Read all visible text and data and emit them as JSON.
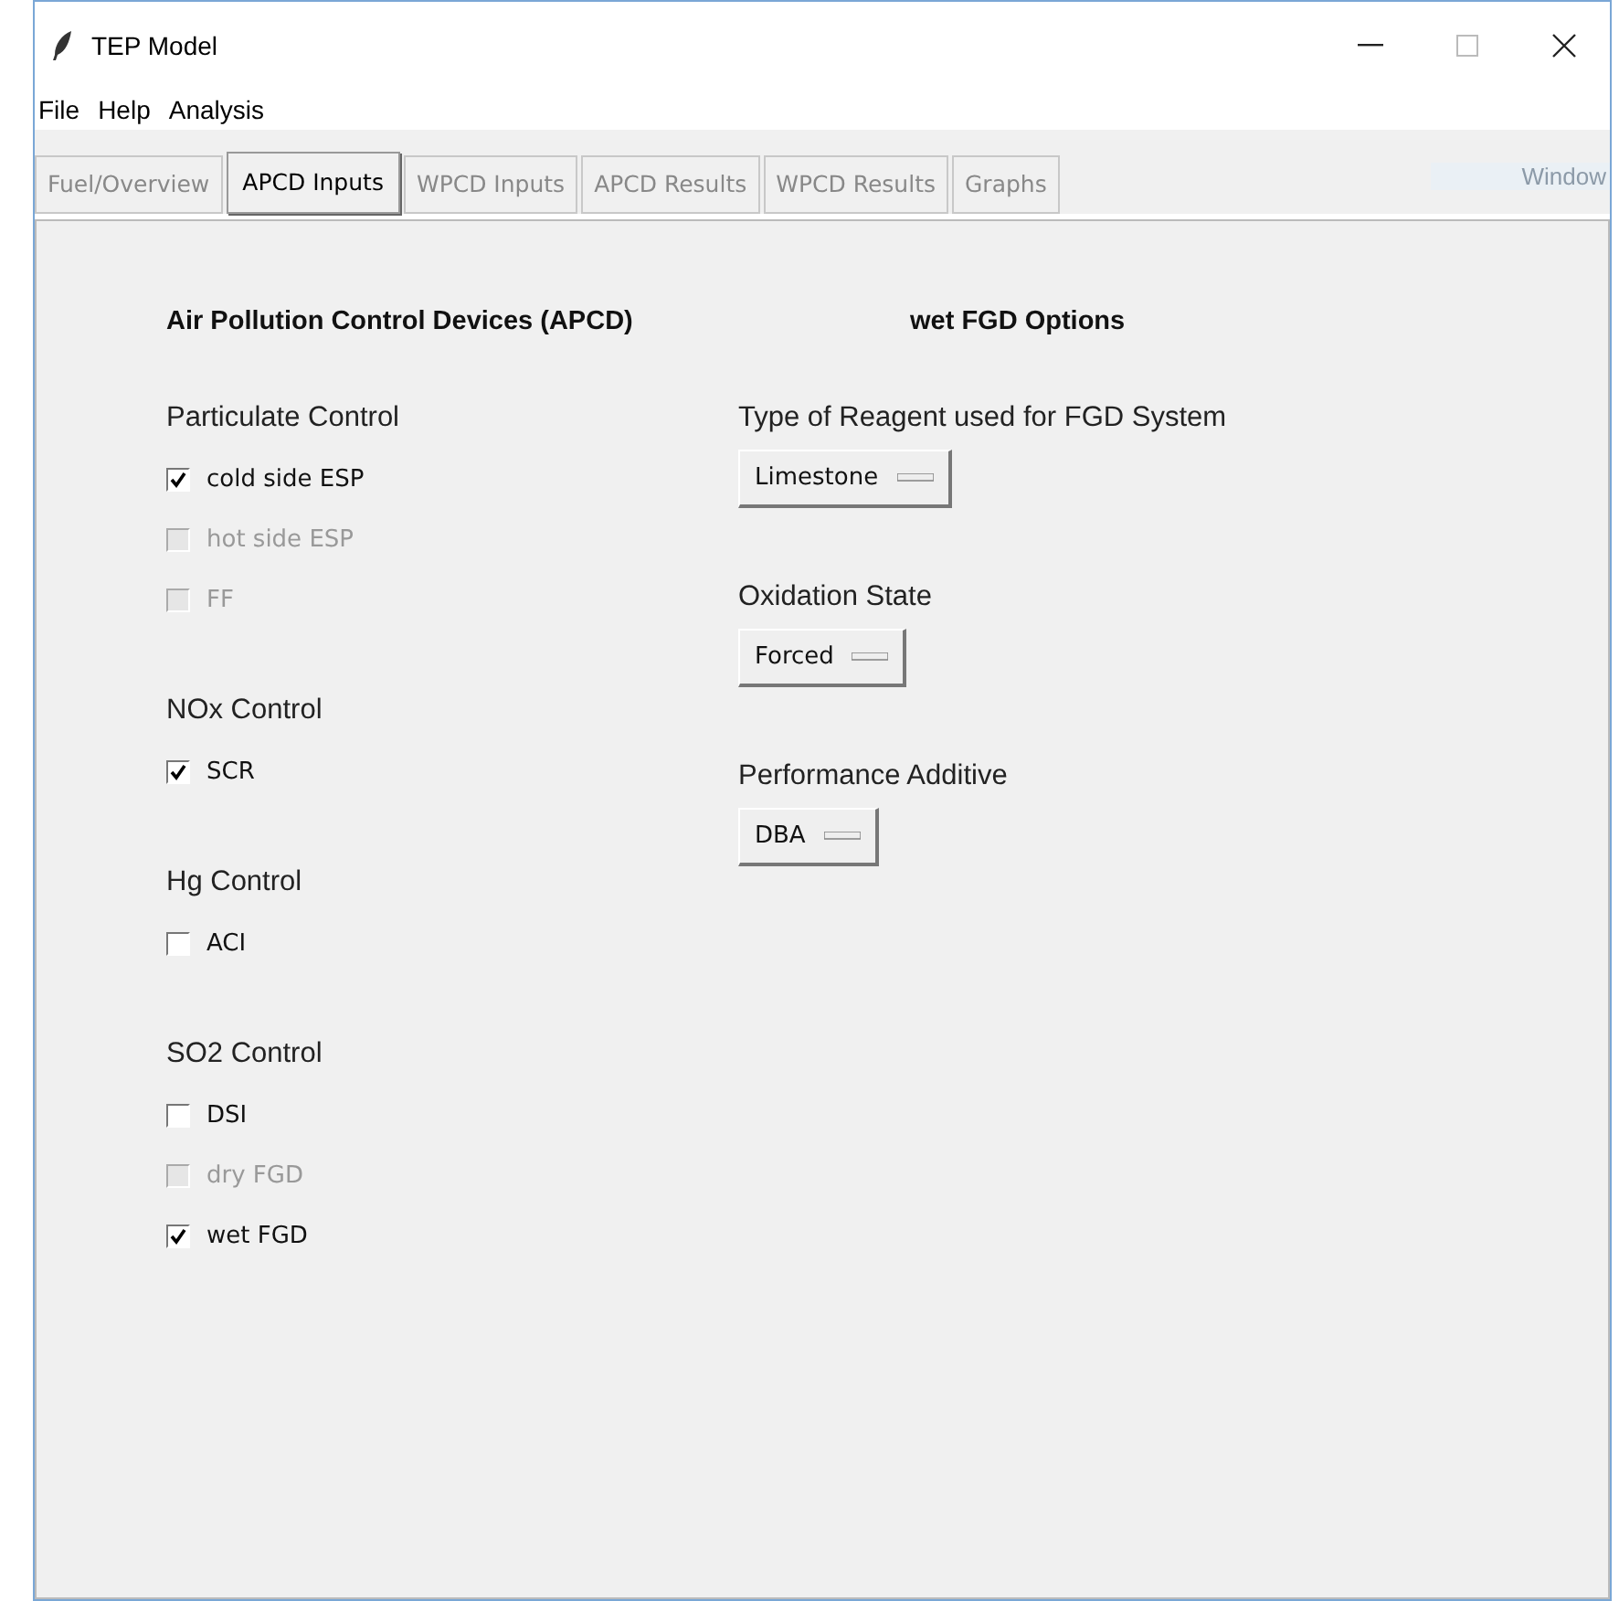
{
  "window": {
    "title": "TEP Model"
  },
  "menu": [
    "File",
    "Help",
    "Analysis"
  ],
  "tabs": [
    {
      "label": "Fuel/Overview",
      "selected": false,
      "disabled": true
    },
    {
      "label": "APCD Inputs",
      "selected": true,
      "disabled": false
    },
    {
      "label": "WPCD Inputs",
      "selected": false,
      "disabled": true
    },
    {
      "label": "APCD Results",
      "selected": false,
      "disabled": true
    },
    {
      "label": "WPCD Results",
      "selected": false,
      "disabled": true
    },
    {
      "label": "Graphs",
      "selected": false,
      "disabled": true
    }
  ],
  "faded_overlay_text": "Window",
  "left": {
    "heading": "Air Pollution Control Devices (APCD)",
    "groups": [
      {
        "label": "Particulate Control",
        "options": [
          {
            "label": "cold side ESP",
            "checked": true,
            "disabled": false
          },
          {
            "label": "hot side ESP",
            "checked": false,
            "disabled": true
          },
          {
            "label": "FF",
            "checked": false,
            "disabled": true
          }
        ]
      },
      {
        "label": "NOx Control",
        "options": [
          {
            "label": "SCR",
            "checked": true,
            "disabled": false
          }
        ]
      },
      {
        "label": "Hg Control",
        "options": [
          {
            "label": "ACI",
            "checked": false,
            "disabled": false
          }
        ]
      },
      {
        "label": "SO2 Control",
        "options": [
          {
            "label": "DSI",
            "checked": false,
            "disabled": false
          },
          {
            "label": "dry FGD",
            "checked": false,
            "disabled": true
          },
          {
            "label": "wet FGD",
            "checked": true,
            "disabled": false
          }
        ]
      }
    ]
  },
  "right": {
    "heading": "wet FGD Options",
    "fields": [
      {
        "label": "Type of Reagent used for FGD System",
        "value": "Limestone"
      },
      {
        "label": "Oxidation State",
        "value": "Forced"
      },
      {
        "label": "Performance Additive",
        "value": "DBA"
      }
    ]
  }
}
